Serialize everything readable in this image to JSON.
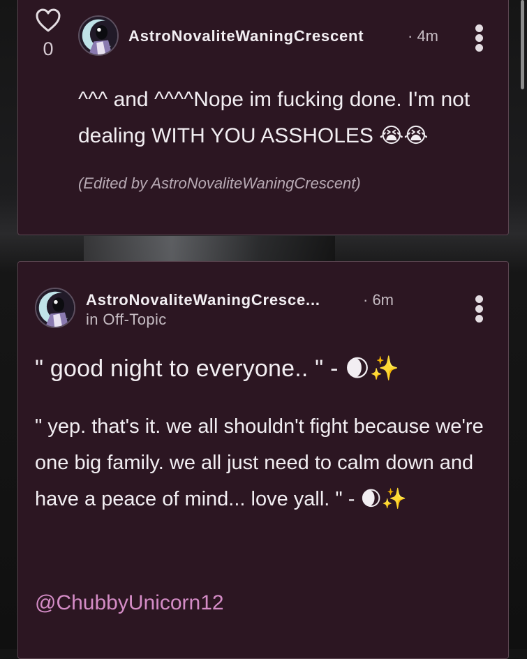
{
  "comment": {
    "like_count": "0",
    "username": "AstroNovaliteWaningCrescent",
    "timestamp": "· 4m",
    "body": "^^^ and ^^^^Nope im fucking done. I'm not dealing WITH YOU ASSHOLES 😭😭",
    "edited_note": "(Edited by AstroNovaliteWaningCrescent)"
  },
  "post": {
    "username": "AstroNovaliteWaningCresce...",
    "timestamp": "· 6m",
    "community": "in Off-Topic",
    "title": "\" good night to everyone.. \" - 🌒✨",
    "body": "\" yep. that's it. we all shouldn't fight because we're one big family. we all just need to calm down and have a peace of mind... love yall. \" - 🌒✨",
    "mention": "@ChubbyUnicorn12"
  },
  "colors": {
    "card_background": "#2c1622",
    "card_border": "#5a4550",
    "mention_link": "#d48cc6",
    "text_primary": "#f2eef2",
    "text_secondary": "#c6bcc3"
  },
  "icons": {
    "like": "heart-icon",
    "menu": "more-vertical-icon",
    "avatar": "moon-avatar"
  }
}
